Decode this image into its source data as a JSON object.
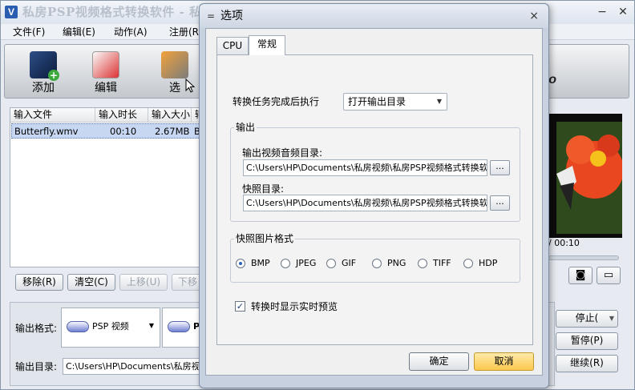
{
  "main": {
    "title": "私房PSP视频格式转换软件 - 私",
    "window_controls": {
      "minimize": "−",
      "close": "✕"
    },
    "menu": [
      "文件(F)",
      "编辑(E)",
      "动作(A)",
      "注册(R"
    ],
    "toolbar": {
      "add": "添加",
      "edit": "编辑",
      "options": "选"
    },
    "brand_fragment": "eo",
    "file_list": {
      "columns": [
        "输入文件",
        "输入时长",
        "输入大小",
        "输"
      ],
      "rows": [
        {
          "file": "Butterfly.wmv",
          "duration": "00:10",
          "size": "2.67MB",
          "extra": "Bu"
        }
      ]
    },
    "list_buttons": {
      "remove": "移除(R)",
      "clear": "清空(C)",
      "up": "上移(U)",
      "down": "下移"
    },
    "output_format_label": "输出格式:",
    "output_format_value": "PSP 视频",
    "output_format_second": "PS",
    "output_dir_label": "输出目录:",
    "output_dir_value": "C:\\Users\\HP\\Documents\\私房视频\\",
    "preview_time": "/ 00:10",
    "side_buttons": {
      "stop": "停止(",
      "pause": "暂停(P)",
      "continue": "继续(R)"
    }
  },
  "dialog": {
    "title": "选项",
    "sys_icon": "=",
    "close": "×",
    "tabs": [
      "CPU",
      "常规"
    ],
    "active_tab": "常规",
    "after_convert_label": "转换任务完成后执行",
    "after_convert_value": "打开输出目录",
    "output_group": "输出",
    "video_audio_dir_label": "输出视频音频目录:",
    "video_audio_dir_value": "C:\\Users\\HP\\Documents\\私房视频\\私房PSP视频格式转换软",
    "snapshot_dir_label": "快照目录:",
    "snapshot_dir_value": "C:\\Users\\HP\\Documents\\私房视频\\私房PSP视频格式转换软",
    "browse": "...",
    "snapshot_format_group": "快照图片格式",
    "formats": [
      "BMP",
      "JPEG",
      "GIF",
      "PNG",
      "TIFF",
      "HDP"
    ],
    "selected_format": "BMP",
    "realtime_preview_label": "转换时显示实时预览",
    "realtime_preview_checked": true,
    "ok": "确定",
    "cancel": "取消"
  }
}
